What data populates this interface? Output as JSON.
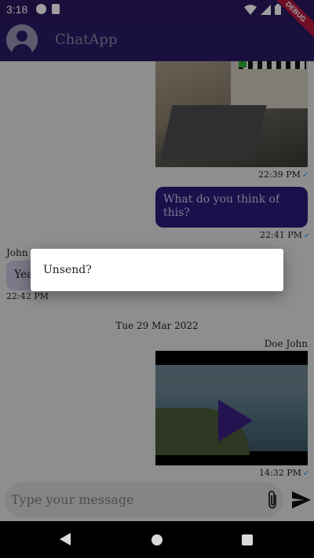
{
  "status_bar": {
    "time": "3:18",
    "debug_label": "DEBUG"
  },
  "app_bar": {
    "title": "ChatApp"
  },
  "messages": {
    "photo_time": "22:39 PM",
    "outgoing_text": "What do you think of this?",
    "outgoing_time": "22:41 PM",
    "incoming_sender": "John S",
    "incoming_text": "Yea",
    "incoming_time": "22:42 PM",
    "date_divider": "Tue 29 Mar 2022",
    "video_sender": "Doe John",
    "video_time": "14:32 PM",
    "read_check": "✓"
  },
  "dialog": {
    "text": "Unsend?"
  },
  "composer": {
    "placeholder": "Type your message"
  },
  "colors": {
    "primary": "#2b1a66",
    "bubble_out": "#2d1a7a",
    "check": "#1e88e5"
  }
}
